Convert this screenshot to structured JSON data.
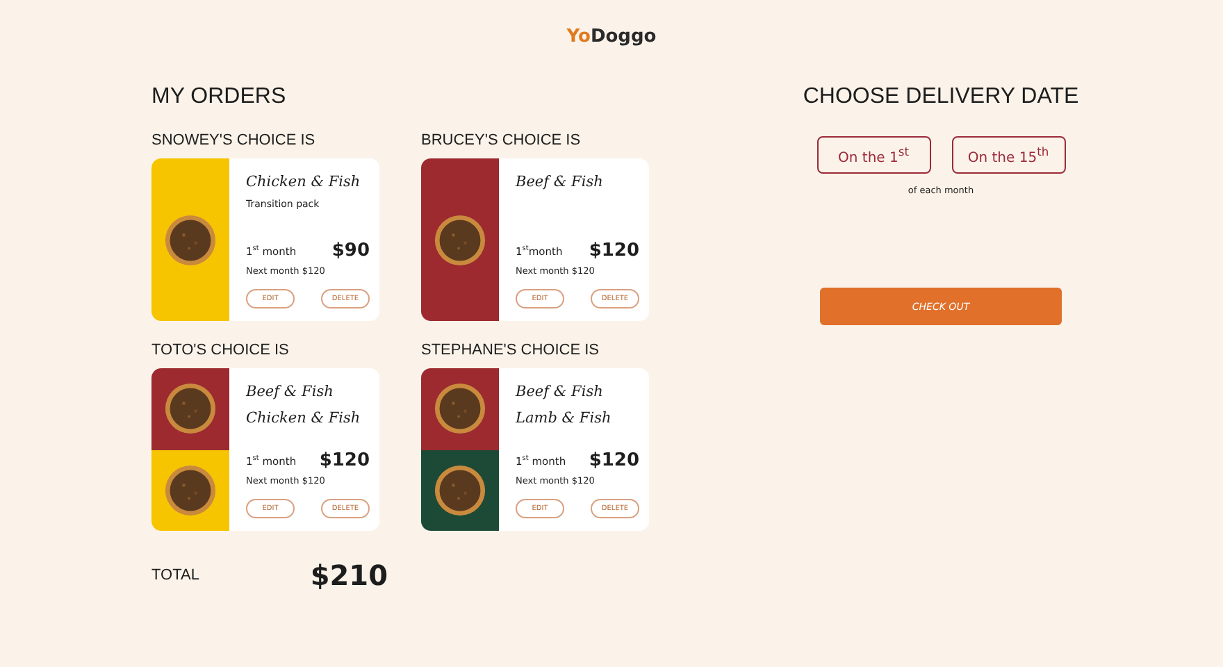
{
  "logo": {
    "accent": "Yo",
    "name": "Doggo"
  },
  "orders_title": "MY ORDERS",
  "orders": [
    {
      "label": "SNOWEY'S CHOICE IS",
      "images": [
        {
          "color": "#f6c500"
        }
      ],
      "recipes": [
        "Chicken & Fish"
      ],
      "note": "Transition pack",
      "first_month": "1$^{st}$ month",
      "price": "$90",
      "next_month": "Next month $120",
      "buttons": [
        "EDIT",
        "DELETE"
      ]
    },
    {
      "label": "BRUCEY'S CHOICE IS",
      "images": [
        {
          "color": "#9c2a2f"
        }
      ],
      "recipes": [
        "Beef & Fish"
      ],
      "first_month": "1$^{st}$month",
      "price": "$120",
      "next_month": "Next month $120",
      "buttons": [
        "EDIT",
        "DELETE"
      ]
    },
    {
      "label": "TOTO'S CHOICE IS",
      "images": [
        {
          "color": "#9c2a2f"
        },
        {
          "color": "#f6c500"
        }
      ],
      "recipes": [
        "Beef & Fish",
        "Chicken & Fish"
      ],
      "first_month": "1$^{st}$ month",
      "price": "$120",
      "next_month": "Next month $120",
      "buttons": [
        "EDIT",
        "DELETE"
      ]
    },
    {
      "label": "STEPHANE'S CHOICE IS",
      "images": [
        {
          "color": "#9c2a2f"
        },
        {
          "color": "#1d4a36"
        }
      ],
      "recipes": [
        "Beef & Fish",
        "Lamb & Fish"
      ],
      "first_month": "1$^{st}$ month",
      "price": "$120",
      "next_month": "Next month $120",
      "buttons": [
        "EDIT",
        "DELETE"
      ]
    }
  ],
  "total": {
    "label": "TOTAL",
    "amount": "$210"
  },
  "delivery": {
    "title": "CHOOSE DELIVERY DATE",
    "options": [
      "On the 1$^{st}$",
      "On the 15$^{th}$"
    ],
    "note": "of each month",
    "checkout": "CHECK OUT"
  }
}
